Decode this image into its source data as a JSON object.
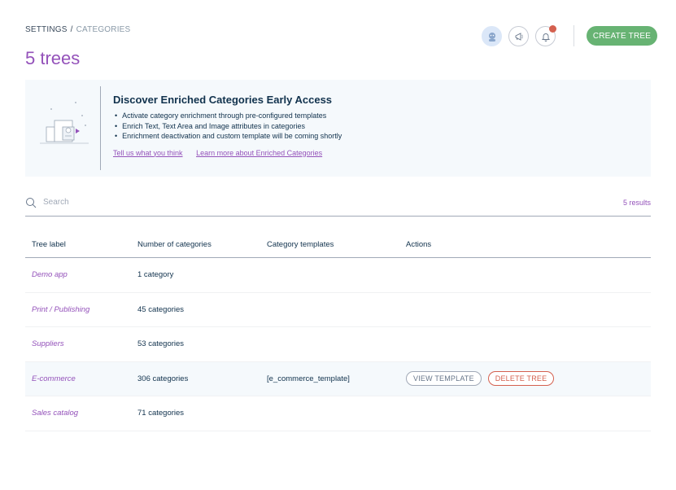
{
  "breadcrumb": {
    "root": "SETTINGS",
    "separator": "/",
    "current": "CATEGORIES"
  },
  "page_title": "5 trees",
  "header": {
    "create_button": "CREATE TREE"
  },
  "banner": {
    "title": "Discover Enriched Categories Early Access",
    "bullets": [
      "Activate category enrichment through pre-configured templates",
      "Enrich Text, Text Area and Image attributes in categories",
      "Enrichment deactivation and custom template will be coming shortly"
    ],
    "links": [
      "Tell us what you think",
      "Learn more about Enriched Categories"
    ]
  },
  "search": {
    "placeholder": "Search",
    "results": "5 results"
  },
  "table": {
    "headers": [
      "Tree label",
      "Number of categories",
      "Category templates",
      "Actions"
    ],
    "rows": [
      {
        "label": "Demo app",
        "count": "1 category",
        "template": ""
      },
      {
        "label": "Print / Publishing",
        "count": "45 categories",
        "template": ""
      },
      {
        "label": "Suppliers",
        "count": "53 categories",
        "template": ""
      },
      {
        "label": "E-commerce",
        "count": "306 categories",
        "template": "[e_commerce_template]",
        "view_button": "VIEW TEMPLATE",
        "delete_button": "DELETE TREE"
      },
      {
        "label": "Sales catalog",
        "count": "71 categories",
        "template": ""
      }
    ]
  },
  "colors": {
    "brand": "#9452ba",
    "primary_button": "#67b373",
    "danger": "#d4604f"
  },
  "icons": [
    "user-avatar-icon",
    "megaphone-icon",
    "bell-icon",
    "search-icon"
  ]
}
